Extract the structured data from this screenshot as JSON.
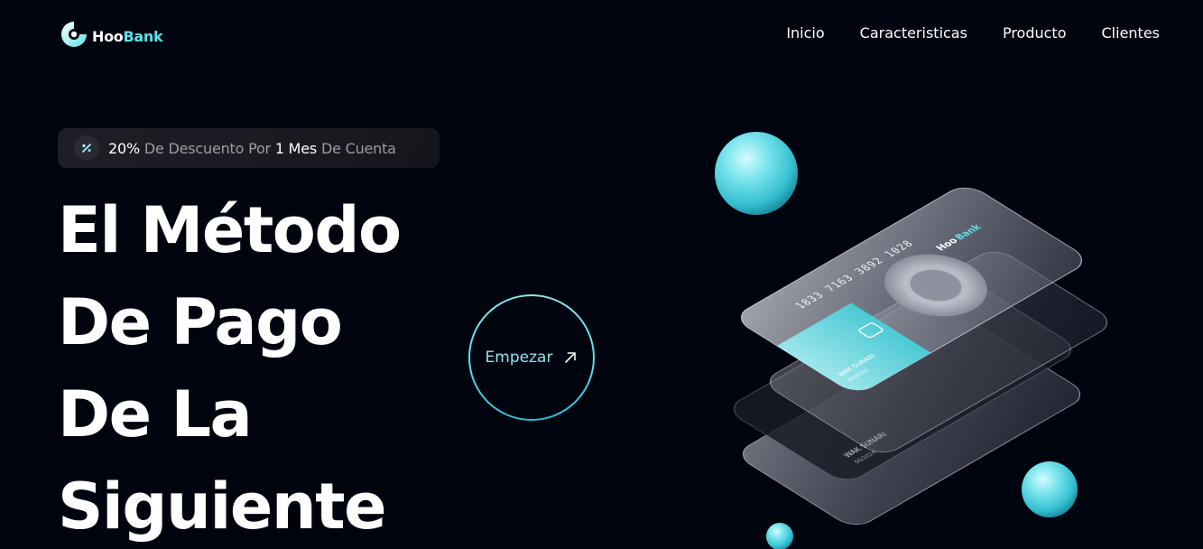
{
  "brand": {
    "name_part1": "Hoo",
    "name_part2": "Bank"
  },
  "nav": {
    "items": [
      {
        "label": "Inicio"
      },
      {
        "label": "Caracteristicas"
      },
      {
        "label": "Producto"
      },
      {
        "label": "Clientes"
      }
    ]
  },
  "badge": {
    "icon": "discount-icon",
    "pct": "20%",
    "text1": " De Descuento Por ",
    "months": "1 Mes",
    "text2": " De Cuenta"
  },
  "hero": {
    "lines": [
      "El Método",
      "De Pago",
      "De La",
      "Siguiente"
    ]
  },
  "cta": {
    "label": "Empezar",
    "icon": "arrow-up-right-icon"
  },
  "cards": {
    "number": "1833 7163 3892 1028",
    "holder": "WAK SUNARI",
    "expiry": "06/2024",
    "brand_part1": "Hoo",
    "brand_part2": "Bank"
  },
  "colors": {
    "background": "#00040f",
    "accent": "#5ce1e6",
    "text_dim": "#9b9da4"
  }
}
